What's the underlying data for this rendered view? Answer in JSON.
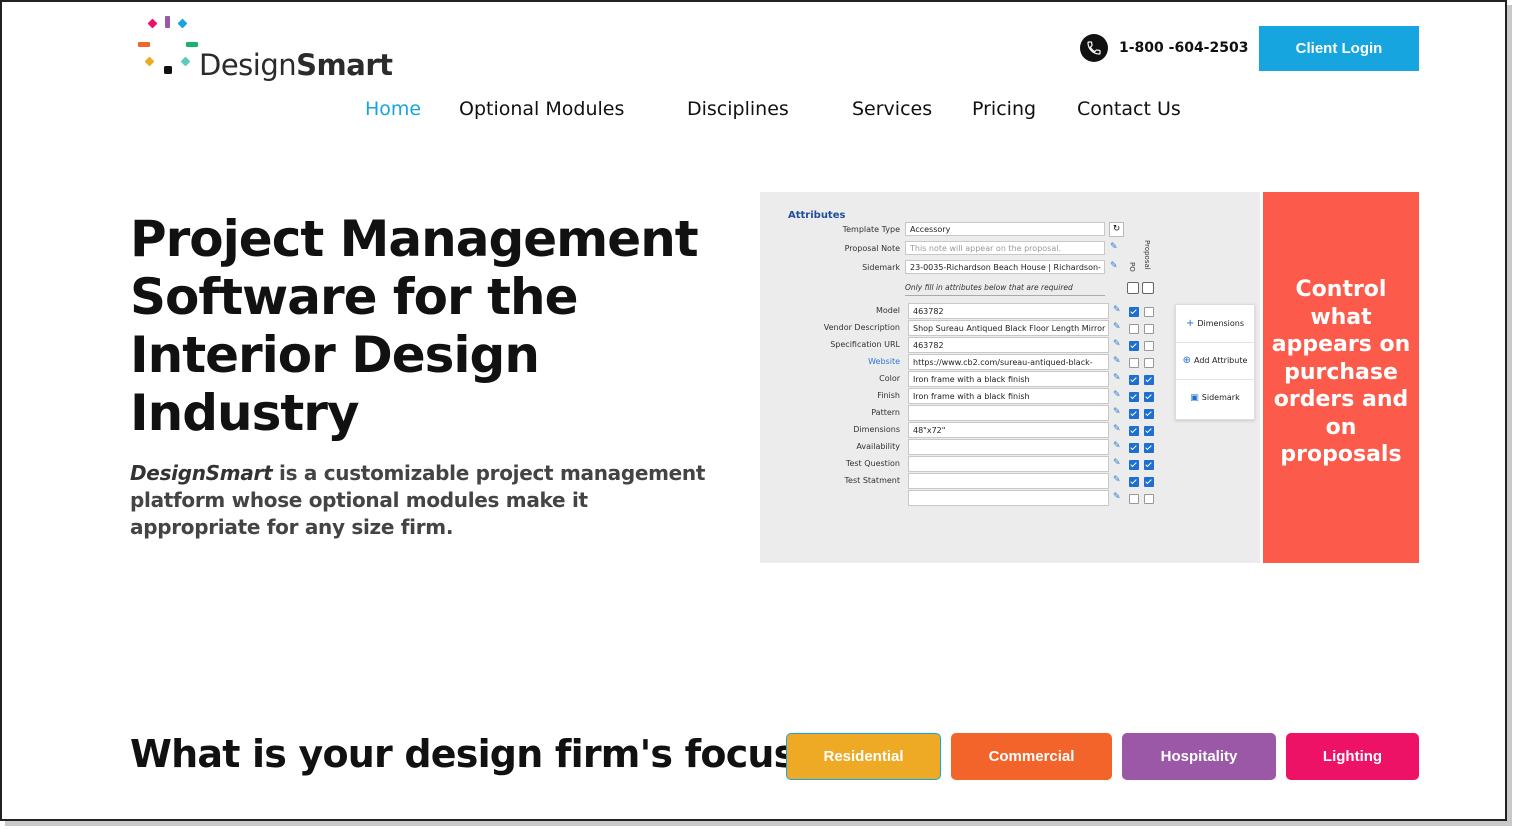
{
  "brand": {
    "name_light": "Design",
    "name_bold": "Smart",
    "colors": {
      "accent_blue": "#16a5df",
      "callout_red": "#fc5a4a"
    }
  },
  "header": {
    "phone_icon": "phone-icon",
    "phone": "1-800 -604-2503",
    "login_label": "Client Login"
  },
  "nav": [
    {
      "label": "Home",
      "active": true
    },
    {
      "label": "Optional Modules"
    },
    {
      "label": "Disciplines"
    },
    {
      "label": "Services"
    },
    {
      "label": "Pricing"
    },
    {
      "label": "Contact Us"
    }
  ],
  "hero": {
    "title": "Project Management Software for the Interior Design Industry",
    "desc_brand": "DesignSmart",
    "desc_rest": " is a customizable project management platform whose optional modules make it appropriate for any size firm."
  },
  "panel": {
    "title": "Attributes",
    "template_type_label": "Template Type",
    "template_type_value": "Accessory",
    "proposal_note_label": "Proposal Note",
    "proposal_note_placeholder": "This note will appear on the proposal.",
    "sidemark_label": "Sidemark",
    "sidemark_value": "23-0035-Richardson Beach House | Richardson-",
    "col_po": "PO",
    "col_proposal": "Proposal",
    "note": "Only fill in attributes below that are required",
    "rows": [
      {
        "label": "Model",
        "value": "463782",
        "po": true,
        "proposal": false
      },
      {
        "label": "Vendor Description",
        "value": "Shop Sureau Antiqued Black Floor Length Mirror",
        "po": false,
        "proposal": false
      },
      {
        "label": "Specification URL",
        "value": "463782",
        "po": true,
        "proposal": false
      },
      {
        "label": "Website",
        "value": "https://www.cb2.com/sureau-antiqued-black-",
        "po": false,
        "proposal": false,
        "link": true
      },
      {
        "label": "Color",
        "value": "Iron frame with a black finish",
        "po": true,
        "proposal": true
      },
      {
        "label": "Finish",
        "value": "Iron frame with a black finish",
        "po": true,
        "proposal": true
      },
      {
        "label": "Pattern",
        "value": "",
        "po": true,
        "proposal": true
      },
      {
        "label": "Dimensions",
        "value": "48\"x72\"",
        "po": true,
        "proposal": true
      },
      {
        "label": "Availability",
        "value": "",
        "po": true,
        "proposal": true
      },
      {
        "label": "Test Question",
        "value": "",
        "po": true,
        "proposal": true
      },
      {
        "label": "Test Statment",
        "value": "",
        "po": true,
        "proposal": true
      },
      {
        "label": "",
        "value": "",
        "po": false,
        "proposal": false
      }
    ],
    "side_buttons": [
      {
        "label": "Dimensions",
        "icon": "plus-icon",
        "glyph": "+"
      },
      {
        "label": "Add Attribute",
        "icon": "add-circle-icon",
        "glyph": "⊕"
      },
      {
        "label": "Sidemark",
        "icon": "sidemark-icon",
        "glyph": "▣"
      }
    ]
  },
  "callout": {
    "text": "Control what appears on purchase orders and on proposals"
  },
  "focus": {
    "title": "What is your design firm's focus?",
    "buttons": [
      {
        "label": "Residential",
        "color": "#eeaa24"
      },
      {
        "label": "Commercial",
        "color": "#f3642a"
      },
      {
        "label": "Hospitality",
        "color": "#9a58a6"
      },
      {
        "label": "Lighting",
        "color": "#ee1267"
      }
    ]
  }
}
